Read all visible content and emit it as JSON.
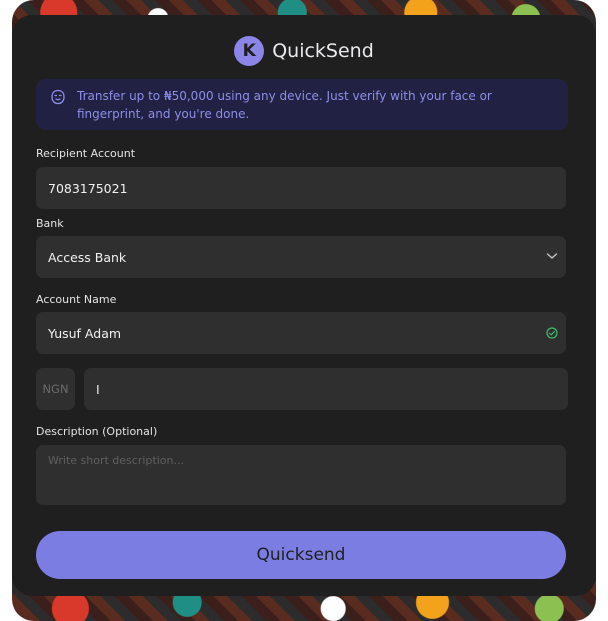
{
  "app": {
    "name": "QuickSend",
    "logo_letter": "K"
  },
  "banner": {
    "text": "Transfer up to ₦50,000 using any device. Just verify with your face or fingerprint, and you're done.",
    "icon": "face-id-icon"
  },
  "form": {
    "recipient_label": "Recipient Account",
    "recipient_value": "7083175021",
    "bank_label": "Bank",
    "bank_value": "Access Bank",
    "account_name_label": "Account Name",
    "account_name_value": "Yusuf Adam",
    "currency": "NGN",
    "amount_value": "I",
    "description_label": "Description (Optional)",
    "description_placeholder": "Write short description..."
  },
  "submit": {
    "label": "Quicksend"
  },
  "colors": {
    "accent": "#7b7de3",
    "card": "#1f1f1f",
    "field": "#2f2f2f",
    "banner_bg": "#212243",
    "success": "#3fbf6a"
  }
}
